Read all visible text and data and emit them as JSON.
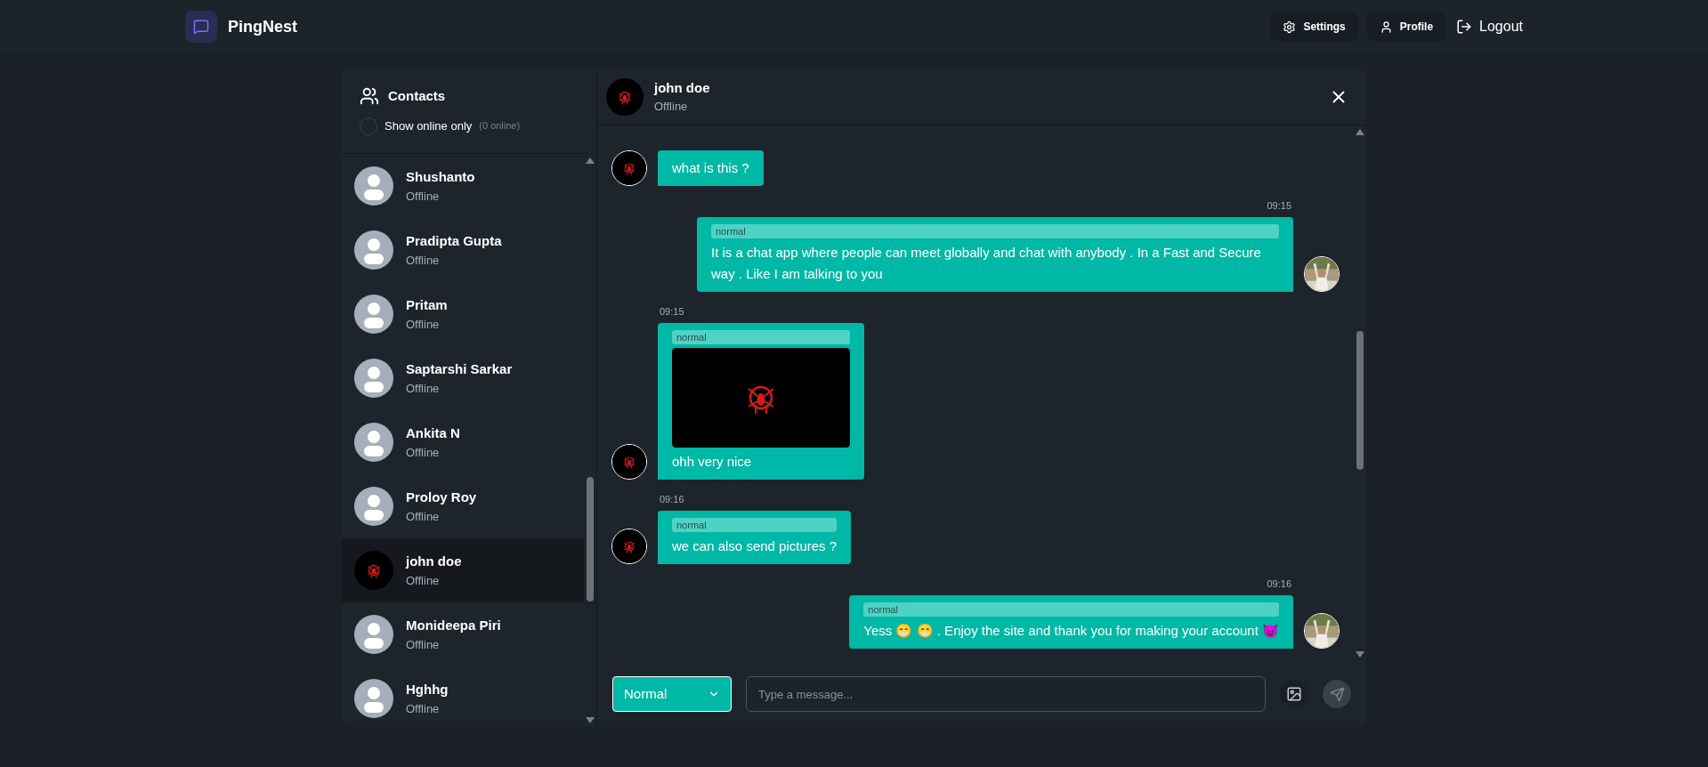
{
  "app": {
    "name": "PingNest"
  },
  "nav": [
    {
      "kind": "settings",
      "label": "Settings"
    },
    {
      "kind": "profile",
      "label": "Profile"
    },
    {
      "kind": "logout",
      "label": "Logout"
    }
  ],
  "contacts_panel": {
    "title": "Contacts",
    "filter": {
      "label": "Show online only",
      "checked": false,
      "count": "(0 online)"
    },
    "contacts": [
      {
        "name": "Shushanto",
        "status": "Offline",
        "avatar": {
          "kind": "default"
        },
        "selected": false
      },
      {
        "name": "Pradipta Gupta",
        "status": "Offline",
        "avatar": {
          "kind": "default"
        },
        "selected": false
      },
      {
        "name": "Pritam",
        "status": "Offline",
        "avatar": {
          "kind": "default"
        },
        "selected": false
      },
      {
        "name": "Saptarshi Sarkar",
        "status": "Offline",
        "avatar": {
          "kind": "default"
        },
        "selected": false
      },
      {
        "name": "Ankita N",
        "status": "Offline",
        "avatar": {
          "kind": "default"
        },
        "selected": false
      },
      {
        "name": "Proloy Roy",
        "status": "Offline",
        "avatar": {
          "kind": "default"
        },
        "selected": false
      },
      {
        "name": "john doe",
        "status": "Offline",
        "selected": true
      },
      {
        "name": "Monideepa Piri",
        "status": "Offline",
        "avatar": {
          "kind": "default"
        },
        "selected": false
      },
      {
        "name": "Hghhg",
        "status": "Offline",
        "avatar": {
          "kind": "default"
        },
        "selected": false
      }
    ]
  },
  "chat": {
    "contact": {
      "name": "john doe",
      "status": "Offline"
    },
    "messages": [
      {
        "mine": false,
        "text": "what is this ?"
      },
      {
        "mine": true,
        "time": "09:15",
        "tag": "normal",
        "text": "It is a chat app where people can meet globally and chat with anybody . In a Fast and Secure way . Like I am talking to you"
      },
      {
        "mine": false,
        "time": "09:15",
        "tag": "normal",
        "text": "ohh very nice"
      },
      {
        "mine": false,
        "time": "09:16",
        "tag": "normal",
        "text": "we can also send pictures ?"
      },
      {
        "mine": true,
        "time": "09:16",
        "tag": "normal",
        "text": "Yess 😁 😁 . Enjoy the site and thank you for making your account 😈"
      }
    ],
    "composer": {
      "mode": "Normal",
      "placeholder": "Type a message..."
    }
  }
}
